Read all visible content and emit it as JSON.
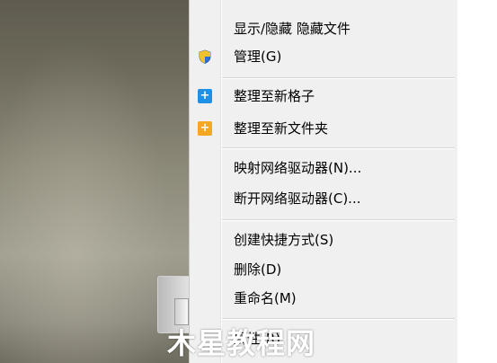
{
  "context_menu": {
    "items": [
      {
        "label": "显示/隐藏 隐藏文件",
        "icon": null
      },
      {
        "label": "管理(G)",
        "icon": "shield-icon"
      },
      {
        "label": "整理至新格子",
        "icon": "new-fence-icon"
      },
      {
        "label": "整理至新文件夹",
        "icon": "new-folder-icon"
      },
      {
        "label": "映射网络驱动器(N)...",
        "icon": null
      },
      {
        "label": "断开网络驱动器(C)...",
        "icon": null
      },
      {
        "label": "创建快捷方式(S)",
        "icon": null
      },
      {
        "label": "删除(D)",
        "icon": null
      },
      {
        "label": "重命名(M)",
        "icon": null
      },
      {
        "label": "属性(R)",
        "icon": null
      }
    ]
  },
  "watermark": {
    "text": "木星教程网"
  },
  "colors": {
    "menu_background": "#f0f0f0",
    "fence_icon": "#1e90e6",
    "folder_icon": "#f5a623",
    "shield_blue": "#2f6fd1",
    "shield_yellow": "#f2c12e"
  }
}
